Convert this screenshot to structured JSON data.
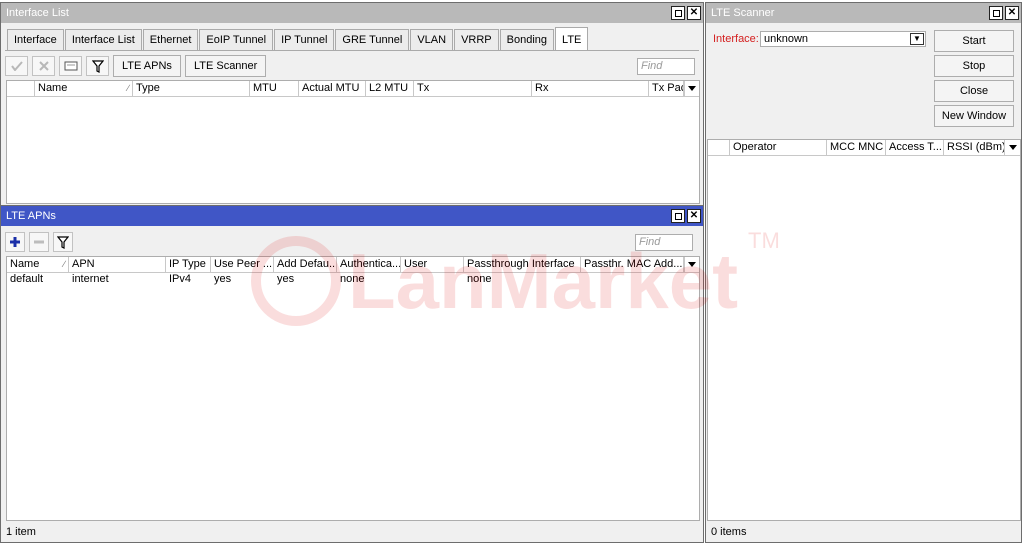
{
  "interface_window": {
    "title": "Interface List",
    "tabs": [
      "Interface",
      "Interface List",
      "Ethernet",
      "EoIP Tunnel",
      "IP Tunnel",
      "GRE Tunnel",
      "VLAN",
      "VRRP",
      "Bonding",
      "LTE"
    ],
    "selected_tab": "LTE",
    "toolbar": {
      "lte_apns_label": "LTE APNs",
      "lte_scanner_label": "LTE Scanner",
      "find_placeholder": "Find"
    },
    "columns": [
      "Name",
      "Type",
      "MTU",
      "Actual MTU",
      "L2 MTU",
      "Tx",
      "Rx",
      "Tx Pack"
    ]
  },
  "apn_window": {
    "title": "LTE APNs",
    "find_placeholder": "Find",
    "columns": [
      "Name",
      "APN",
      "IP Type",
      "Use Peer ...",
      "Add Defau...",
      "Authentica...",
      "User",
      "Passthrough Interface",
      "Passthr. MAC Add..."
    ],
    "rows": [
      [
        "default",
        "internet",
        "IPv4",
        "yes",
        "yes",
        "none",
        "",
        "none",
        ""
      ]
    ],
    "status": "1 item"
  },
  "scanner_window": {
    "title": "LTE Scanner",
    "interface_label": "Interface:",
    "interface_value": "unknown",
    "buttons": {
      "start": "Start",
      "stop": "Stop",
      "close": "Close",
      "new_window": "New Window"
    },
    "columns": [
      "Operator",
      "MCC MNC",
      "Access T...",
      "RSSI (dBm)"
    ],
    "status": "0 items"
  },
  "watermark": {
    "text": "LanMarket",
    "trademark": "TM"
  }
}
